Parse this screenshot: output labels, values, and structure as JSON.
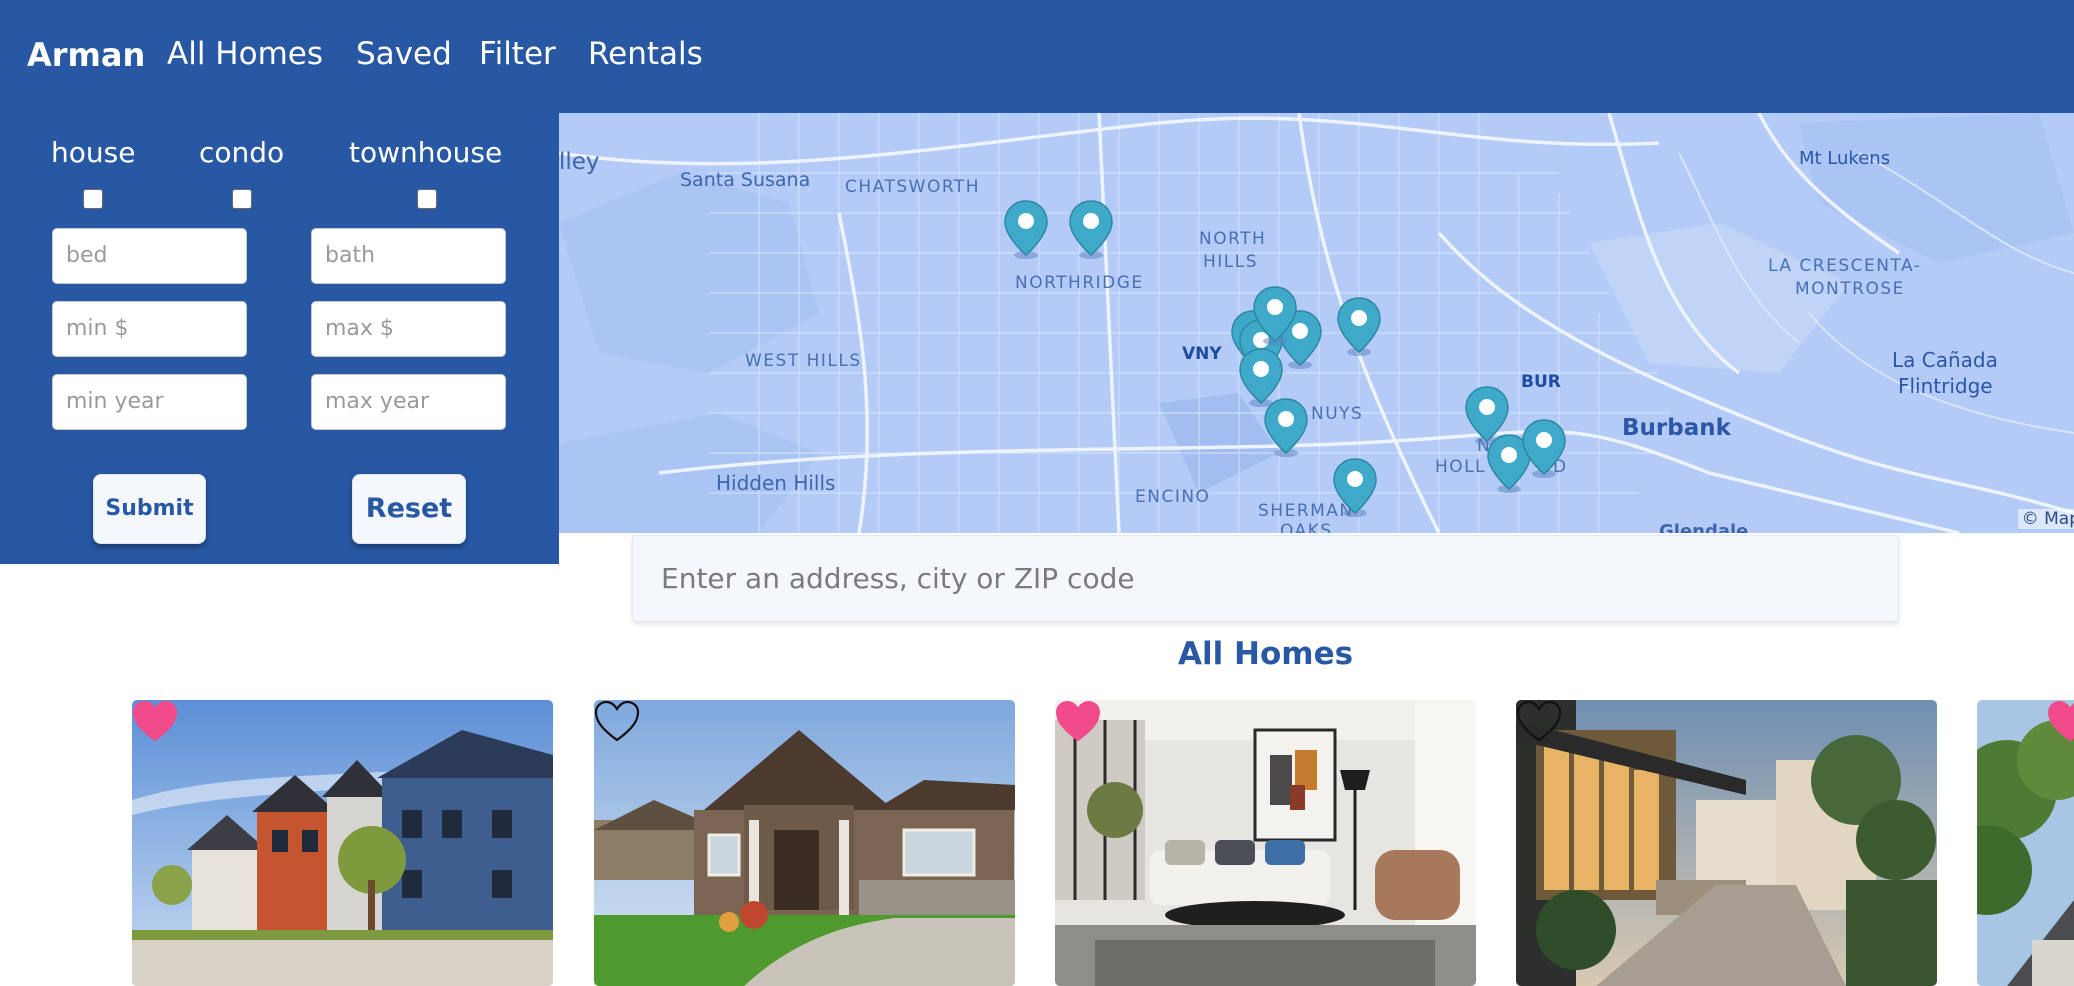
{
  "header": {
    "brand": "Arman",
    "nav": [
      "All Homes",
      "Saved",
      "Filter",
      "Rentals"
    ]
  },
  "filters": {
    "property_types": [
      {
        "label": "house",
        "checked": false
      },
      {
        "label": "condo",
        "checked": false
      },
      {
        "label": "townhouse",
        "checked": false
      }
    ],
    "placeholders": {
      "bed": "bed",
      "bath": "bath",
      "min_price": "min $",
      "max_price": "max $",
      "min_year": "min year",
      "max_year": "max year"
    },
    "submit_label": "Submit",
    "reset_label": "Reset"
  },
  "map": {
    "labels": {
      "valley": "lley",
      "santa_susana": "Santa Susana",
      "chatsworth": "CHATSWORTH",
      "northridge": "NORTHRIDGE",
      "north_hills_1": "NORTH",
      "north_hills_2": "HILLS",
      "west_hills": "WEST HILLS",
      "vny": "VNY",
      "van_nuys": "NUYS",
      "hidden_hills": "Hidden Hills",
      "encino": "ENCINO",
      "sherman_oaks_1": "SHERMAN",
      "sherman_oaks_2": "OAKS",
      "north_hollywood_1": "N",
      "north_hollywood_2": "HOLL",
      "north_hollywood_3": "D",
      "bur": "BUR",
      "burbank": "Burbank",
      "mt_lukens": "Mt Lukens",
      "la_crescenta_1": "LA CRESCENTA-",
      "la_crescenta_2": "MONTROSE",
      "la_canada_1": "La Cañada",
      "la_canada_2": "Flintridge",
      "glendale": "Glendale"
    },
    "attribution": "© Map",
    "pin_color": "#3fa9c9"
  },
  "search": {
    "placeholder": "Enter an address, city or ZIP code"
  },
  "section_title": "All Homes",
  "listings": [
    {
      "saved": true,
      "photo": "townhouses-exterior"
    },
    {
      "saved": false,
      "photo": "craftsman-house-exterior"
    },
    {
      "saved": true,
      "photo": "modern-living-room"
    },
    {
      "saved": false,
      "photo": "modern-courtyard-walkway"
    },
    {
      "saved": true,
      "photo": "house-with-trees"
    }
  ],
  "colors": {
    "brand": "#2858a3",
    "heart_saved": "#f14b8c",
    "heart_unsaved": "#111111"
  }
}
